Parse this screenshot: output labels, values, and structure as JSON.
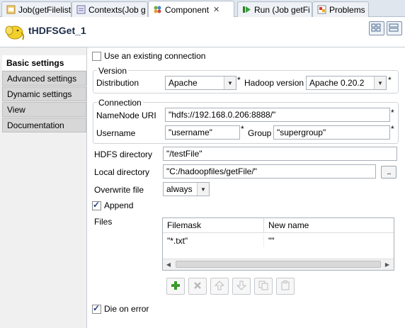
{
  "tabs": [
    {
      "label": "Job(getFilelist",
      "icon": "job-icon"
    },
    {
      "label": "Contexts(Job g",
      "icon": "contexts-icon"
    },
    {
      "label": "Component",
      "icon": "component-icon"
    },
    {
      "label": "Run (Job getFi",
      "icon": "run-icon"
    },
    {
      "label": "Problems",
      "icon": "problems-icon"
    }
  ],
  "header": {
    "title": "tHDFSGet_1"
  },
  "nav": {
    "items": [
      {
        "label": "Basic settings"
      },
      {
        "label": "Advanced settings"
      },
      {
        "label": "Dynamic settings"
      },
      {
        "label": "View"
      },
      {
        "label": "Documentation"
      }
    ]
  },
  "form": {
    "use_existing_connection": {
      "label": "Use an existing connection",
      "checked": false
    },
    "version_group": {
      "title": "Version",
      "distribution_label": "Distribution",
      "distribution_value": "Apache",
      "hadoop_version_label": "Hadoop version",
      "hadoop_version_value": "Apache 0.20.2"
    },
    "connection_group": {
      "title": "Connection",
      "namenode_label": "NameNode URI",
      "namenode_value": "\"hdfs://192.168.0.206:8888/\"",
      "username_label": "Username",
      "username_value": "\"username\"",
      "group_label": "Group",
      "group_value": "\"supergroup\""
    },
    "hdfs_directory_label": "HDFS directory",
    "hdfs_directory_value": "\"/testFile\"",
    "local_directory_label": "Local directory",
    "local_directory_value": "\"C:/hadoopfiles/getFile/\"",
    "browse_label": "...",
    "overwrite_label": "Overwrite file",
    "overwrite_value": "always",
    "append": {
      "label": "Append",
      "checked": true
    },
    "files_label": "Files",
    "files_table": {
      "columns": [
        "Filemask",
        "New name"
      ],
      "rows": [
        [
          "\"*.txt\"",
          "\"\""
        ]
      ]
    },
    "die_on_error": {
      "label": "Die on error",
      "checked": true
    },
    "required_mark": "*"
  }
}
